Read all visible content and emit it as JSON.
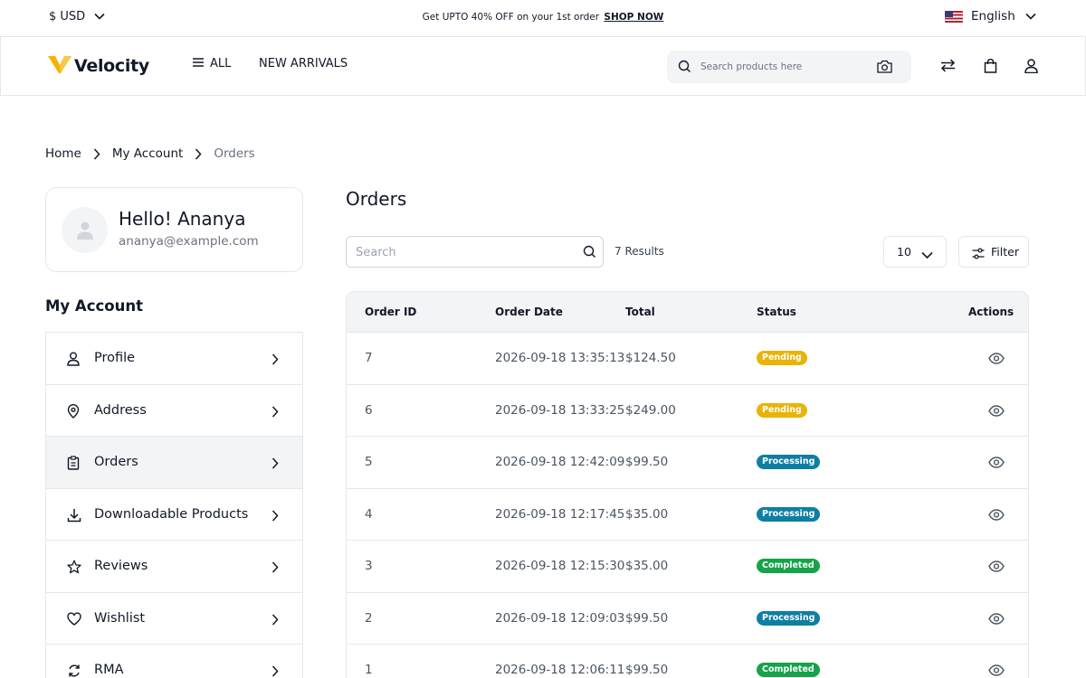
{
  "topbar": {
    "currency": "$ USD",
    "promo_text": "Get UPTO 40% OFF on your 1st order",
    "promo_link": "SHOP NOW",
    "language": "English"
  },
  "header": {
    "logo_text": "Velocity",
    "nav_all": "ALL",
    "nav_new_arrivals": "NEW ARRIVALS",
    "search_placeholder": "Search products here"
  },
  "breadcrumb": {
    "home": "Home",
    "account": "My Account",
    "current": "Orders"
  },
  "profile": {
    "greeting": "Hello! Ananya",
    "email": "ananya@example.com"
  },
  "sidebar": {
    "title": "My Account",
    "items": [
      {
        "label": "Profile",
        "icon": "user-icon"
      },
      {
        "label": "Address",
        "icon": "location-pin-icon"
      },
      {
        "label": "Orders",
        "icon": "clipboard-icon",
        "active": true
      },
      {
        "label": "Downloadable Products",
        "icon": "download-icon"
      },
      {
        "label": "Reviews",
        "icon": "star-icon"
      },
      {
        "label": "Wishlist",
        "icon": "heart-icon"
      },
      {
        "label": "RMA",
        "icon": "return-arrows-icon"
      }
    ]
  },
  "orders": {
    "title": "Orders",
    "search_placeholder": "Search",
    "results_text": "7 Results",
    "per_page": "10",
    "filter_label": "Filter",
    "columns": [
      "Order ID",
      "Order Date",
      "Total",
      "Status",
      "Actions"
    ],
    "rows": [
      {
        "id": "7",
        "date": "2026-09-18 13:35:13",
        "total": "$124.50",
        "status": "Pending"
      },
      {
        "id": "6",
        "date": "2026-09-18 13:33:25",
        "total": "$249.00",
        "status": "Pending"
      },
      {
        "id": "5",
        "date": "2026-09-18 12:42:09",
        "total": "$99.50",
        "status": "Processing"
      },
      {
        "id": "4",
        "date": "2026-09-18 12:17:45",
        "total": "$35.00",
        "status": "Processing"
      },
      {
        "id": "3",
        "date": "2026-09-18 12:15:30",
        "total": "$35.00",
        "status": "Completed"
      },
      {
        "id": "2",
        "date": "2026-09-18 12:09:03",
        "total": "$99.50",
        "status": "Processing"
      },
      {
        "id": "1",
        "date": "2026-09-18 12:06:11",
        "total": "$99.50",
        "status": "Completed"
      }
    ]
  },
  "status_colors": {
    "Pending": "#eab308",
    "Processing": "#0e7fa3",
    "Completed": "#16a34a"
  }
}
